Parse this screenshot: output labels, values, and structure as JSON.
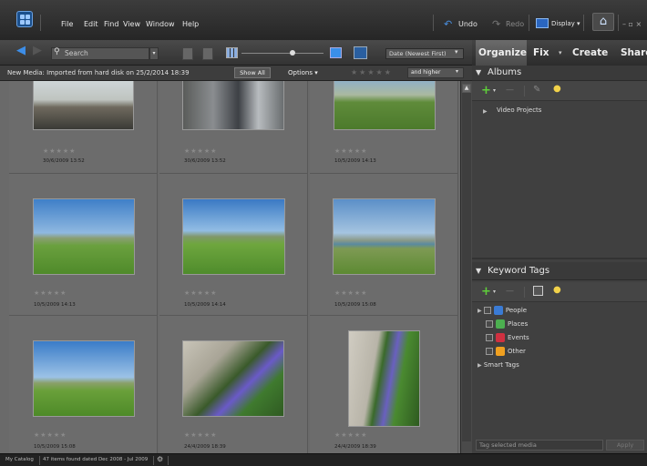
{
  "menu": {
    "file": "File",
    "edit": "Edit",
    "find": "Find",
    "view": "View",
    "window": "Window",
    "help": "Help"
  },
  "topbar": {
    "undo": "Undo",
    "redo": "Redo",
    "display": "Display ▾",
    "window_controls": "– ▫ ×"
  },
  "toolbar": {
    "search_placeholder": "Search",
    "sort_value": "Date (Newest First)"
  },
  "tabs": {
    "organize": "Organize",
    "fix": "Fix",
    "create": "Create",
    "share": "Share"
  },
  "infobar": {
    "text": "New Media: Imported from hard disk on 25/2/2014 18:39",
    "show_all": "Show All",
    "options": "Options ▾",
    "rating_filter": "and higher"
  },
  "photos": [
    {
      "date": "30/6/2009 13:52",
      "stars": "★★★★★"
    },
    {
      "date": "30/6/2009 13:52",
      "stars": "★★★★★"
    },
    {
      "date": "10/5/2009 14:13",
      "stars": "★★★★★"
    },
    {
      "date": "10/5/2009 14:13",
      "stars": "★★★★★"
    },
    {
      "date": "10/5/2009 14:14",
      "stars": "★★★★★"
    },
    {
      "date": "10/5/2009 15:08",
      "stars": "★★★★★"
    },
    {
      "date": "10/5/2009 15:08",
      "stars": "★★★★★"
    },
    {
      "date": "24/4/2009 18:39",
      "stars": "★★★★★"
    },
    {
      "date": "24/4/2009 18:39",
      "stars": "★★★★★"
    }
  ],
  "albums": {
    "title": "Albums",
    "video_projects": "Video Projects"
  },
  "keyword_tags": {
    "title": "Keyword Tags",
    "people": "People",
    "places": "Places",
    "events": "Events",
    "other": "Other",
    "smart_tags": "Smart Tags",
    "tag_input_placeholder": "Tag selected media",
    "apply": "Apply"
  },
  "status": {
    "catalog": "My Catalog",
    "count": "47 items found dated Dec 2008 - Jul 2009"
  },
  "colors": {
    "people": "#3a7bd5",
    "places": "#4caf50",
    "events": "#d03040",
    "other": "#f0a020",
    "accent_green": "#5fcf3a"
  }
}
